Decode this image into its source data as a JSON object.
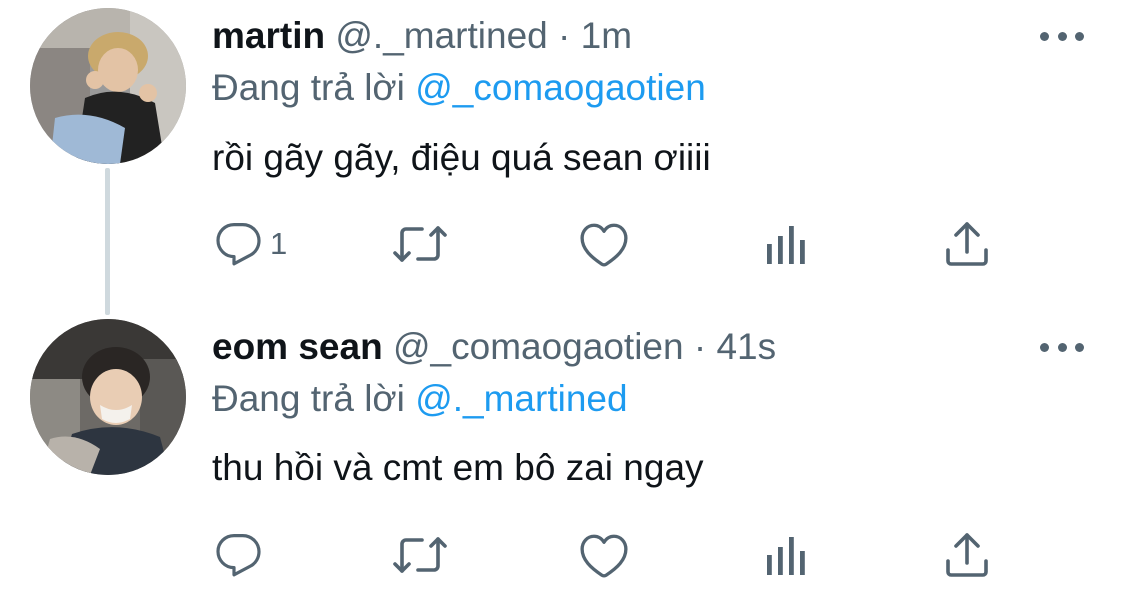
{
  "tweets": [
    {
      "name": "martin",
      "handle": "@._martined",
      "separator": "·",
      "time": "1m",
      "replying_prefix": "Đang trả lời",
      "replying_to": "@_comaogaotien",
      "text": "rồi gãy gãy, điệu quá sean ơiiii",
      "reply_count": "1",
      "icons": [
        "reply-icon",
        "retweet-icon",
        "like-icon",
        "analytics-icon",
        "share-icon",
        "more-icon"
      ]
    },
    {
      "name": "eom sean",
      "handle": "@_comaogaotien",
      "separator": "·",
      "time": "41s",
      "replying_prefix": "Đang trả lời",
      "replying_to": "@._martined",
      "text": "thu hồi và cmt em bô zai ngay",
      "reply_count": "",
      "icons": [
        "reply-icon",
        "retweet-icon",
        "like-icon",
        "analytics-icon",
        "share-icon",
        "more-icon"
      ]
    }
  ],
  "colors": {
    "text": "#0f1419",
    "secondary": "#536471",
    "mention": "#1d9bf0",
    "thread_line": "#cfd9de"
  }
}
